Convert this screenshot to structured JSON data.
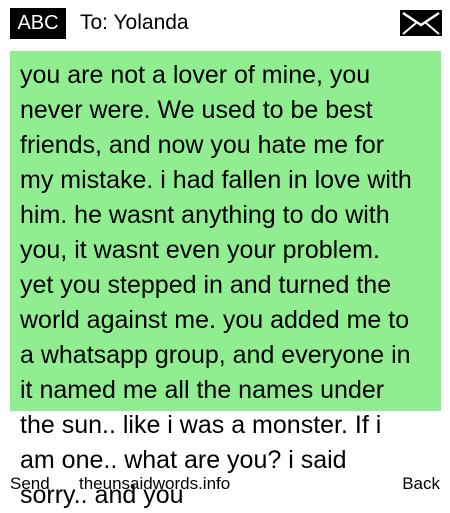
{
  "header": {
    "input_mode": "ABC",
    "recipient": "To: Yolanda",
    "icon": "envelope-icon"
  },
  "message": {
    "text": "you are not a lover of mine, you never were. We used to be best friends, and now you hate me for my mistake. i had fallen in love with him. he wasnt anything to do with you, it wasnt even your problem. yet you stepped in and turned the world against me. you added me to a whatsapp group, and everyone in it named me all the names under the sun.. like i was a monster. If i am one.. what are you? i said sorry.. and you"
  },
  "softkeys": {
    "left": "Send",
    "center": "theunsaidwords.info",
    "right": "Back"
  },
  "colors": {
    "message_background": "#90ee90",
    "badge_background": "#000000"
  }
}
